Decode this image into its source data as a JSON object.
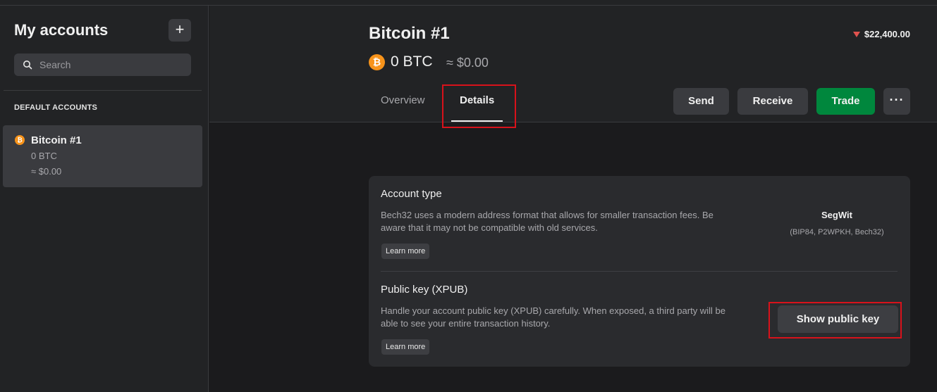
{
  "sidebar": {
    "title": "My accounts",
    "add_label": "+",
    "search_placeholder": "Search",
    "section_label": "DEFAULT ACCOUNTS",
    "accounts": [
      {
        "coin_symbol": "₿",
        "name": "Bitcoin #1",
        "balance": "0 BTC",
        "fiat": "≈ $0.00"
      }
    ]
  },
  "header": {
    "title": "Bitcoin #1",
    "price_change": "$22,400.00",
    "coin_symbol": "₿",
    "balance_crypto": "0 BTC",
    "balance_fiat": "≈ $0.00",
    "tabs": [
      {
        "label": "Overview",
        "active": false
      },
      {
        "label": "Details",
        "active": true
      }
    ],
    "buttons": {
      "send": "Send",
      "receive": "Receive",
      "trade": "Trade",
      "more": "···"
    }
  },
  "details": {
    "account_type": {
      "title": "Account type",
      "description": "Bech32 uses a modern address format that allows for smaller transaction fees. Be aware that it may not be compatible with old services.",
      "learn_more": "Learn more",
      "value": "SegWit",
      "value_sub": "(BIP84, P2WPKH, Bech32)"
    },
    "public_key": {
      "title": "Public key (XPUB)",
      "description": "Handle your account public key (XPUB) carefully. When exposed, a third party will be able to see your entire transaction history.",
      "learn_more": "Learn more",
      "button": "Show public key"
    }
  },
  "colors": {
    "accent_trade": "#00873d",
    "bitcoin": "#f7931a",
    "price_down": "#e0524e",
    "highlight": "#d8121b"
  }
}
